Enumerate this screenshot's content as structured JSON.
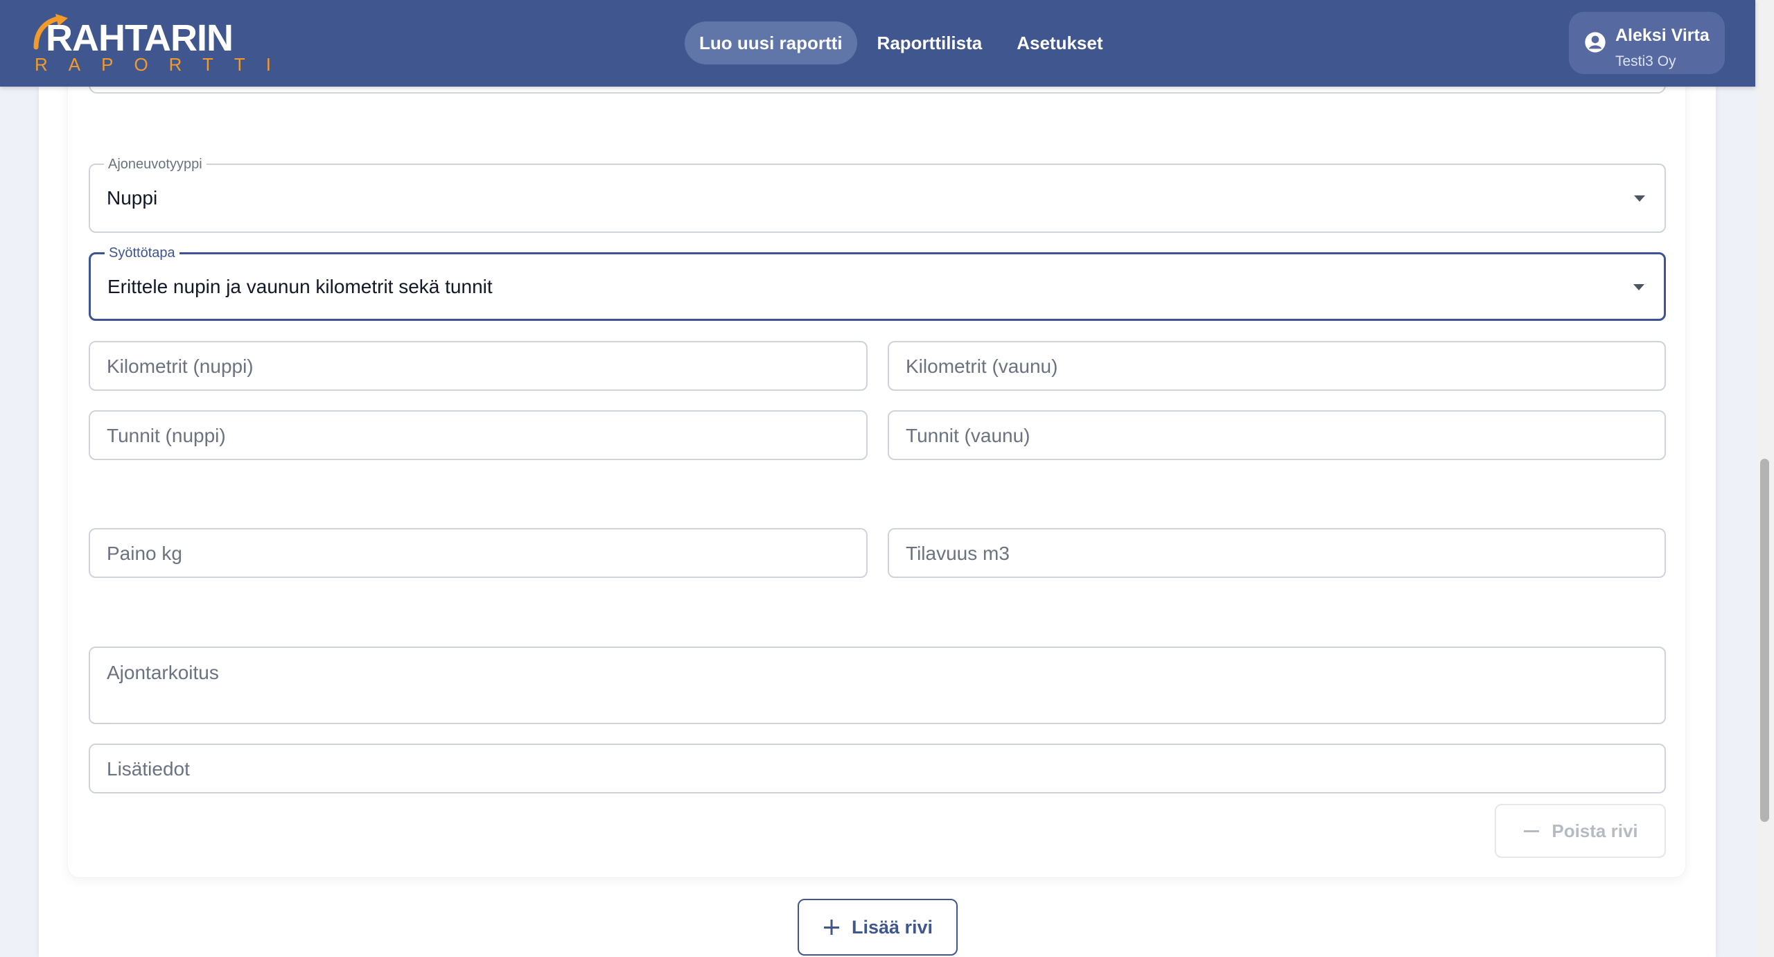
{
  "header": {
    "logo": {
      "title": "RAHTARIN",
      "subtitle": "RAPORTTI"
    },
    "nav": [
      {
        "label": "Luo uusi raportti",
        "active": true
      },
      {
        "label": "Raporttilista",
        "active": false
      },
      {
        "label": "Asetukset",
        "active": false
      }
    ],
    "user": {
      "name": "Aleksi Virta",
      "company": "Testi3 Oy",
      "icon": "account-circle-icon"
    }
  },
  "form": {
    "vehicle_type": {
      "label": "Ajoneuvotyyppi",
      "value": "Nuppi"
    },
    "input_method": {
      "label": "Syöttötapa",
      "value": "Erittele nupin ja vaunun kilometrit sekä tunnit"
    },
    "km_tractor": {
      "placeholder": "Kilometrit (nuppi)"
    },
    "km_trailer": {
      "placeholder": "Kilometrit (vaunu)"
    },
    "hours_tractor": {
      "placeholder": "Tunnit (nuppi)"
    },
    "hours_trailer": {
      "placeholder": "Tunnit (vaunu)"
    },
    "weight": {
      "placeholder": "Paino kg"
    },
    "volume": {
      "placeholder": "Tilavuus m3"
    },
    "purpose": {
      "placeholder": "Ajontarkoitus"
    },
    "details": {
      "placeholder": "Lisätiedot"
    },
    "delete_row": {
      "label": "Poista rivi",
      "icon": "minus-icon",
      "disabled": true
    }
  },
  "actions": {
    "add_row": {
      "label": "Lisää rivi",
      "icon": "plus-icon"
    }
  },
  "colors": {
    "header": "#40568f",
    "accent": "#f39a2b",
    "focus": "#3d5494"
  }
}
